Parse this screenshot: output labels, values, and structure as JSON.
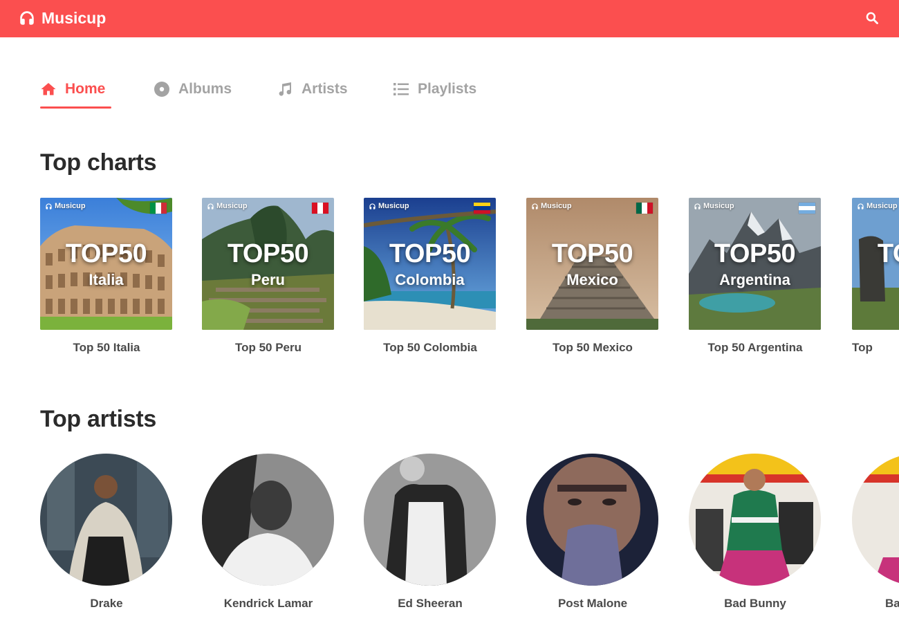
{
  "app": {
    "name": "Musicup"
  },
  "nav": {
    "tabs": [
      {
        "label": "Home",
        "icon": "home-icon",
        "active": true
      },
      {
        "label": "Albums",
        "icon": "disc-icon",
        "active": false
      },
      {
        "label": "Artists",
        "icon": "music-note-icon",
        "active": false
      },
      {
        "label": "Playlists",
        "icon": "list-icon",
        "active": false
      }
    ]
  },
  "charts": {
    "title": "Top charts",
    "cover_brand": "Musicup",
    "cover_heading": "TOP50",
    "items": [
      {
        "country": "Italia",
        "caption": "Top 50 Italia",
        "flag": [
          "#009246",
          "#ffffff",
          "#ce2b37"
        ],
        "flag_layout": "vertical"
      },
      {
        "country": "Peru",
        "caption": "Top 50 Peru",
        "flag": [
          "#d91023",
          "#ffffff",
          "#d91023"
        ],
        "flag_layout": "vertical"
      },
      {
        "country": "Colombia",
        "caption": "Top 50 Colombia",
        "flag": [
          "#fcd116",
          "#003893",
          "#ce1126"
        ],
        "flag_layout": "horizontal"
      },
      {
        "country": "Mexico",
        "caption": "Top 50 Mexico",
        "flag": [
          "#006847",
          "#ffffff",
          "#ce1126"
        ],
        "flag_layout": "vertical"
      },
      {
        "country": "Argentina",
        "caption": "Top 50 Argentina",
        "flag": [
          "#74acdf",
          "#ffffff",
          "#74acdf"
        ],
        "flag_layout": "horizontal"
      },
      {
        "country": "",
        "caption": "Top",
        "flag": [
          "#0039a6",
          "#ffffff",
          "#d52b1e"
        ],
        "flag_layout": "horizontal"
      }
    ]
  },
  "artists": {
    "title": "Top artists",
    "items": [
      {
        "name": "Drake"
      },
      {
        "name": "Kendrick Lamar"
      },
      {
        "name": "Ed Sheeran"
      },
      {
        "name": "Post Malone"
      },
      {
        "name": "Bad Bunny"
      },
      {
        "name": "Ba"
      }
    ]
  },
  "colors": {
    "accent": "#fb4f4f",
    "tab_inactive": "#a3a3a3",
    "heading": "#2b2b2b"
  }
}
